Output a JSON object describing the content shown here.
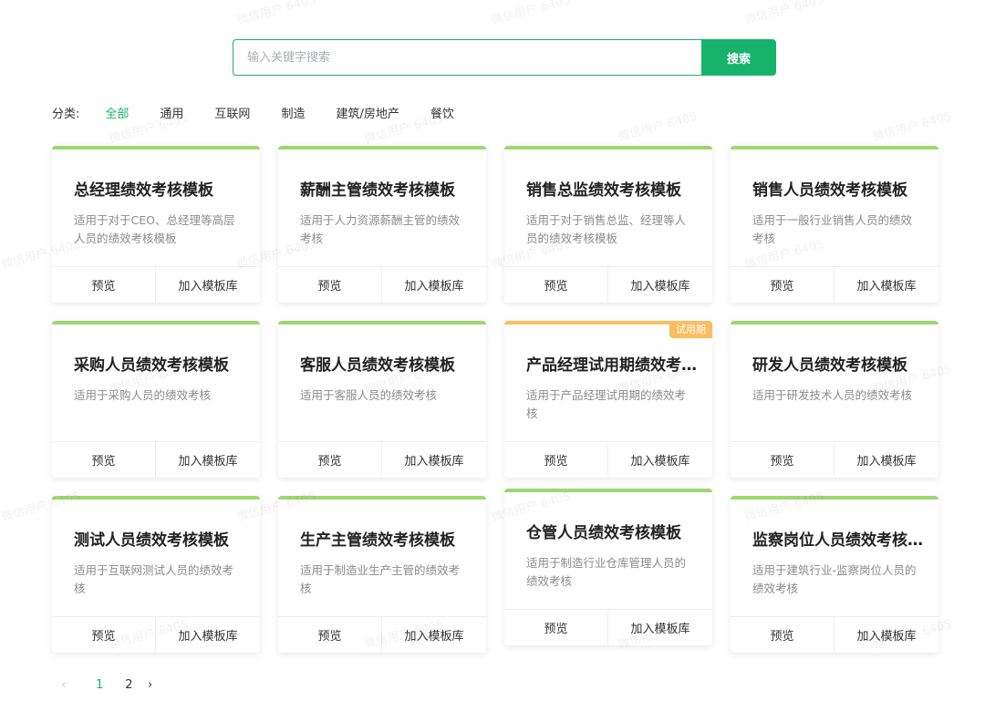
{
  "search": {
    "placeholder": "输入关键字搜索",
    "button_label": "搜索"
  },
  "categories": {
    "label": "分类:",
    "items": [
      "全部",
      "通用",
      "互联网",
      "制造",
      "建筑/房地产",
      "餐饮"
    ],
    "active": "全部"
  },
  "cards": [
    {
      "title": "总经理绩效考核模板",
      "desc": "适用于对于CEO、总经理等高层人员的绩效考核模板",
      "preview": "预览",
      "add": "加入模板库"
    },
    {
      "title": "薪酬主管绩效考核模板",
      "desc": "适用于人力资源薪酬主管的绩效考核",
      "preview": "预览",
      "add": "加入模板库"
    },
    {
      "title": "销售总监绩效考核模板",
      "desc": "适用于对于销售总监、经理等人员的绩效考核模板",
      "preview": "预览",
      "add": "加入模板库"
    },
    {
      "title": "销售人员绩效考核模板",
      "desc": "适用于一般行业销售人员的绩效考核",
      "preview": "预览",
      "add": "加入模板库"
    },
    {
      "title": "采购人员绩效考核模板",
      "desc": "适用于采购人员的绩效考核",
      "preview": "预览",
      "add": "加入模板库"
    },
    {
      "title": "客服人员绩效考核模板",
      "desc": "适用于客服人员的绩效考核",
      "preview": "预览",
      "add": "加入模板库"
    },
    {
      "title": "产品经理试用期绩效考核模板",
      "desc": "适用于产品经理试用期的绩效考核",
      "preview": "预览",
      "add": "加入模板库",
      "badge": "试用期"
    },
    {
      "title": "研发人员绩效考核模板",
      "desc": "适用于研发技术人员的绩效考核",
      "preview": "预览",
      "add": "加入模板库"
    },
    {
      "title": "测试人员绩效考核模板",
      "desc": "适用于互联网测试人员的绩效考核",
      "preview": "预览",
      "add": "加入模板库"
    },
    {
      "title": "生产主管绩效考核模板",
      "desc": "适用于制造业生产主管的绩效考核",
      "preview": "预览",
      "add": "加入模板库"
    },
    {
      "title": "仓管人员绩效考核模板",
      "desc": "适用于制造行业仓库管理人员的绩效考核",
      "preview": "预览",
      "add": "加入模板库"
    },
    {
      "title": "监察岗位人员绩效考核模板",
      "desc": "适用于建筑行业-监察岗位人员的绩效考核",
      "preview": "预览",
      "add": "加入模板库"
    }
  ],
  "pagination": {
    "prev_icon": "chevron-left-icon",
    "next_icon": "chevron-right-icon",
    "pages": [
      "1",
      "2"
    ],
    "current": "1"
  },
  "watermark": "微信用户 6405",
  "colors": {
    "accent": "#18b36b",
    "card_top_green": "#9cd86e",
    "card_top_orange": "#fbbd5f"
  }
}
